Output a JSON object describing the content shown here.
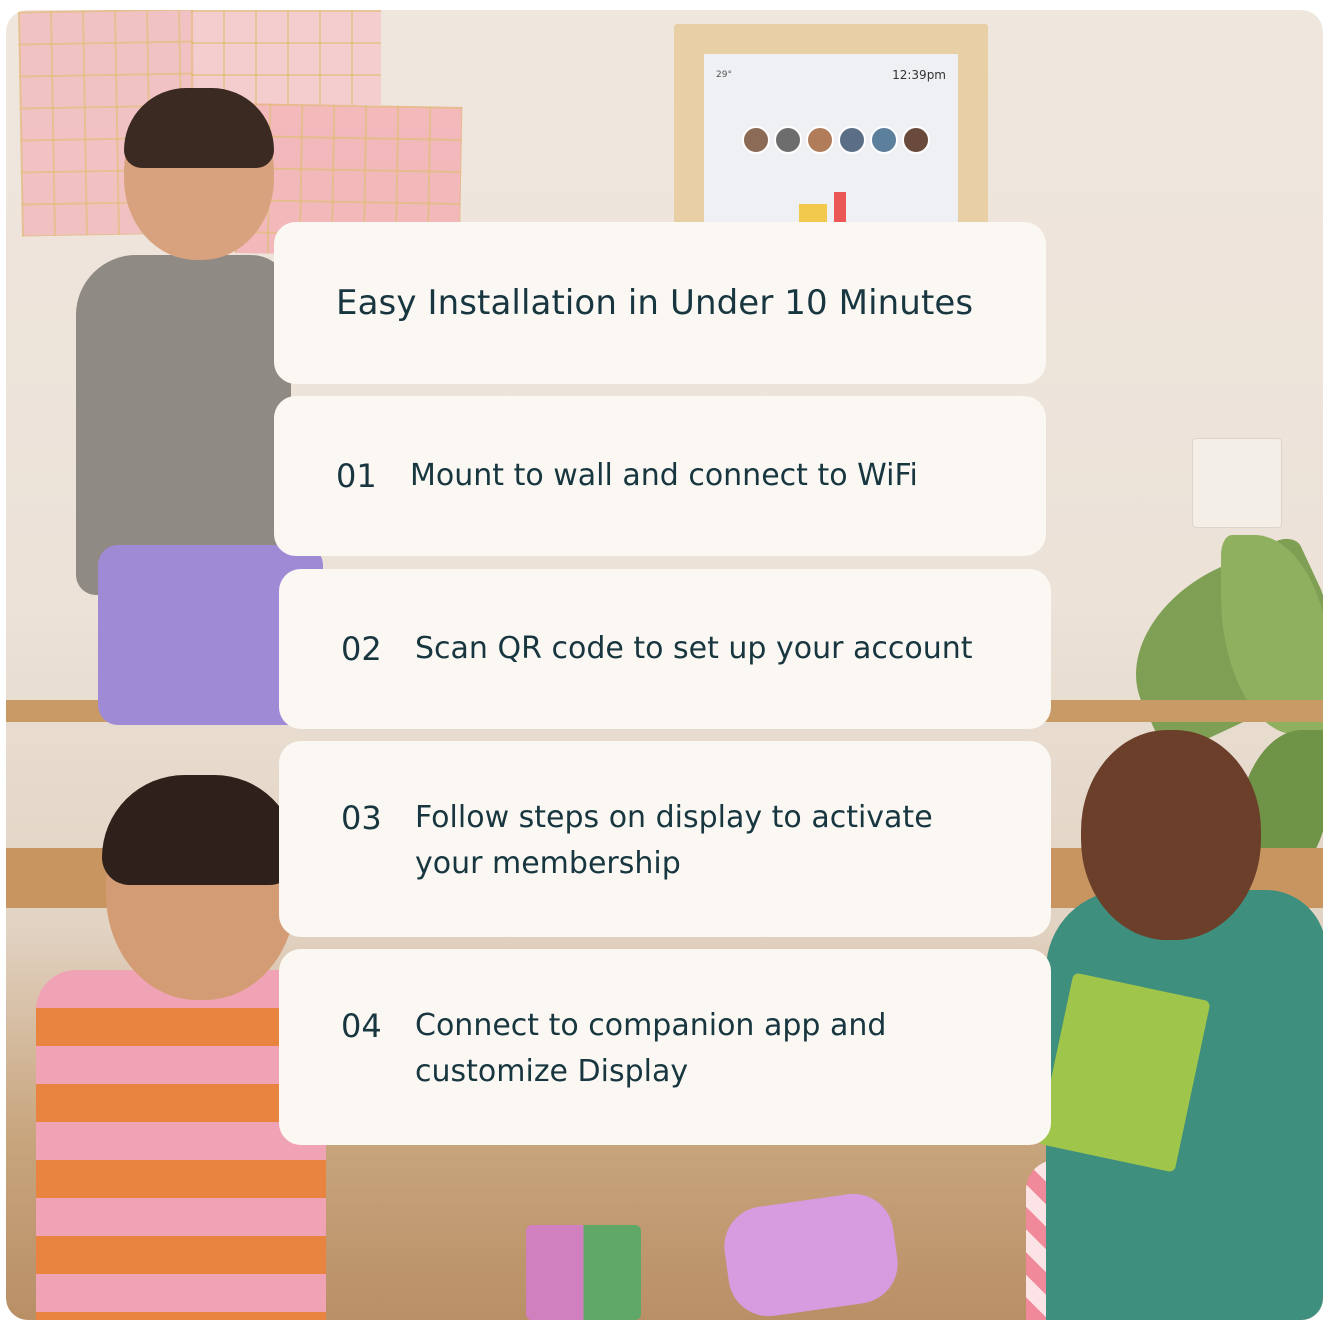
{
  "title": "Easy Installation in Under 10 Minutes",
  "display": {
    "temperature": "29°",
    "time": "12:39pm"
  },
  "steps": [
    {
      "number": "01",
      "text": "Mount to wall and connect to WiFi"
    },
    {
      "number": "02",
      "text": "Scan QR code to set up your account"
    },
    {
      "number": "03",
      "text": "Follow steps on display to activate your membership"
    },
    {
      "number": "04",
      "text": "Connect to companion app and customize Display"
    }
  ],
  "colors": {
    "card_background": "#fbf8f3",
    "text": "#17363f"
  }
}
